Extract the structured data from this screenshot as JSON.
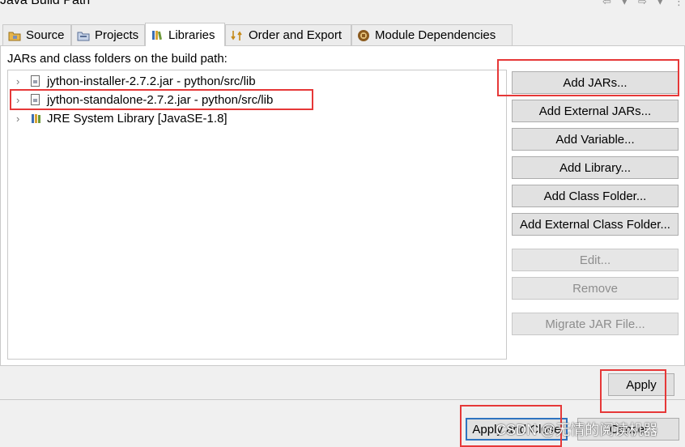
{
  "header": {
    "title": "Java Build Path"
  },
  "tabs": [
    {
      "label": "Source",
      "icon": "source-folder-icon"
    },
    {
      "label": "Projects",
      "icon": "projects-icon"
    },
    {
      "label": "Libraries",
      "icon": "libraries-icon",
      "active": true
    },
    {
      "label": "Order and Export",
      "icon": "order-export-icon"
    },
    {
      "label": "Module Dependencies",
      "icon": "module-icon"
    }
  ],
  "libraries": {
    "label": "JARs and class folders on the build path:",
    "items": [
      {
        "label": "jython-installer-2.7.2.jar - python/src/lib",
        "icon": "jar-icon"
      },
      {
        "label": "jython-standalone-2.7.2.jar - python/src/lib",
        "icon": "jar-icon"
      },
      {
        "label": "JRE System Library [JavaSE-1.8]",
        "icon": "library-icon"
      }
    ]
  },
  "buttons": {
    "add_jars": "Add JARs...",
    "add_external_jars": "Add External JARs...",
    "add_variable": "Add Variable...",
    "add_library": "Add Library...",
    "add_class_folder": "Add Class Folder...",
    "add_external_class_folder": "Add External Class Folder...",
    "edit": "Edit...",
    "remove": "Remove",
    "migrate_jar": "Migrate JAR File..."
  },
  "footer": {
    "apply": "Apply",
    "apply_and_close": "Apply and Close",
    "cancel": "Cancel",
    "watermark": "CSDN @无情的阅读机器"
  },
  "colors": {
    "annotation": "#e63838"
  }
}
